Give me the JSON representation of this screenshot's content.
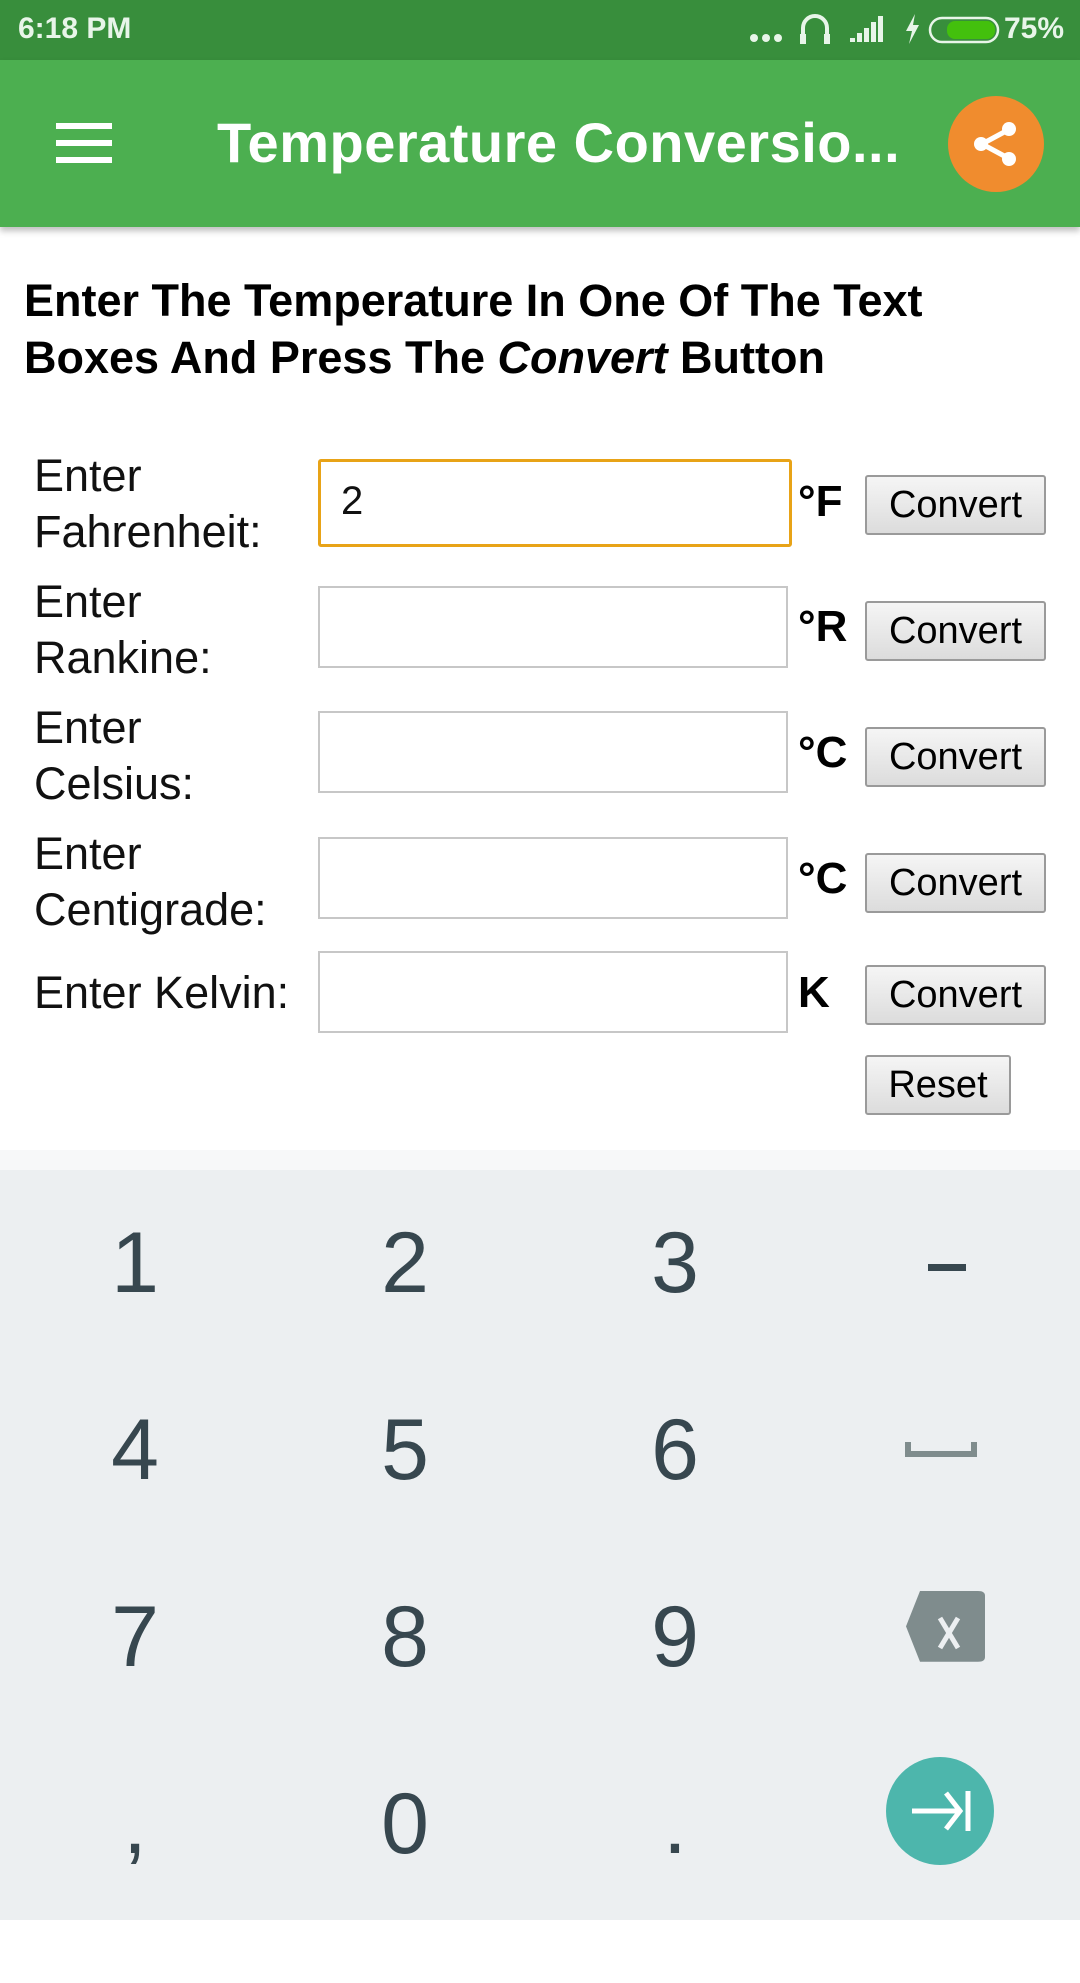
{
  "status_bar": {
    "time": "6:18 PM",
    "battery_percent": "75%",
    "battery_level": 0.75,
    "icons": [
      "more-dots-icon",
      "headphones-icon",
      "signal-icon",
      "charging-bolt-icon",
      "battery-icon"
    ]
  },
  "toolbar": {
    "title": "Temperature Conversio...",
    "menu_icon": "hamburger-menu-icon",
    "share_icon": "share-icon",
    "colors": {
      "primary": "#4caf50",
      "primary_dark": "#388e3c",
      "accent": "#f08c2e"
    }
  },
  "instructions": {
    "part1": "Enter The Temperature In One Of The Text Boxes And Press The ",
    "emphasis": "Convert",
    "part2": " Button"
  },
  "rows": [
    {
      "label_line1": "Enter",
      "label_line2": "Fahrenheit:",
      "value": "2",
      "unit": "°F",
      "button": "Convert",
      "focused": true
    },
    {
      "label_line1": "Enter",
      "label_line2": "Rankine:",
      "value": "",
      "unit": "°R",
      "button": "Convert"
    },
    {
      "label_line1": "Enter",
      "label_line2": "Celsius:",
      "value": "",
      "unit": "°C",
      "button": "Convert"
    },
    {
      "label_line1": "Enter",
      "label_line2": "Centigrade:",
      "value": "",
      "unit": "°C",
      "button": "Convert"
    },
    {
      "label_line1": "Enter Kelvin:",
      "value": "",
      "unit": "K",
      "button": "Convert"
    }
  ],
  "reset_label": "Reset",
  "keyboard": {
    "rows": [
      [
        "1",
        "2",
        "3",
        "-"
      ],
      [
        "4",
        "5",
        "6",
        "space"
      ],
      [
        "7",
        "8",
        "9",
        "backspace"
      ],
      [
        ",",
        "0",
        ".",
        "next"
      ]
    ],
    "next_color": "#4db6ac"
  }
}
